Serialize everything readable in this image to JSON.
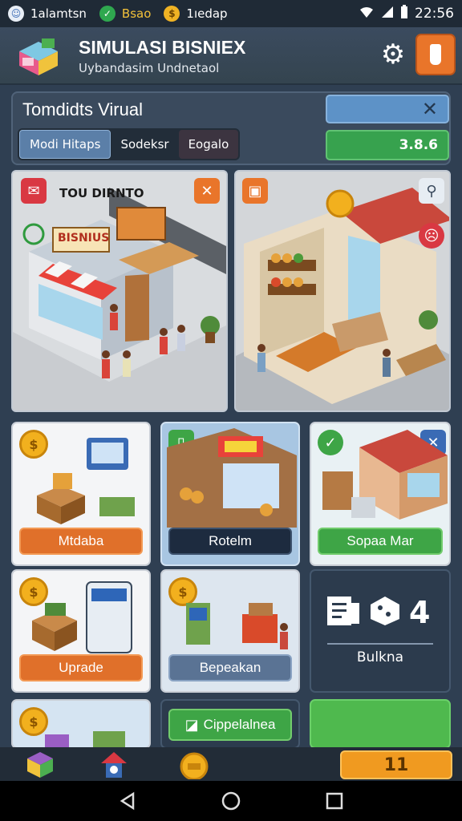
{
  "status_bar": {
    "item1": "1alamtsn",
    "item2": "Bsao",
    "item3": "1ıedap",
    "time": "22:56"
  },
  "header": {
    "title": "SIMULASI BISNIEX",
    "subtitle": "Uybandasim Undnetaol"
  },
  "panel": {
    "title": "Tomdidts Virual",
    "tabs": [
      {
        "label": "Modi Hitaps"
      },
      {
        "label": "Sodeksr"
      },
      {
        "label": "Eogalo"
      }
    ],
    "value": "3.8.6"
  },
  "scenes": {
    "left_label": "TOU DIRNTO",
    "left_sign": "BISNIUS"
  },
  "cards": [
    {
      "label": "Mtdaba"
    },
    {
      "label": "Rotelm"
    },
    {
      "label": "Sopaa Mar"
    },
    {
      "label": "Uprade"
    },
    {
      "label": "Bepeakan"
    }
  ],
  "stat": {
    "value": "4",
    "label": "Bulkna"
  },
  "partial_button": "Cippelalnea",
  "bottom_button": "11",
  "colors": {
    "accent_orange": "#e0702a",
    "accent_green": "#3ea546",
    "header_bg": "#3b4b5f",
    "page_bg": "#2f3f52"
  },
  "icons": [
    "settings-gear-icon",
    "alert-icon",
    "close-icon",
    "coin-icon",
    "store-icon",
    "back-icon",
    "home-icon",
    "recents-icon"
  ]
}
